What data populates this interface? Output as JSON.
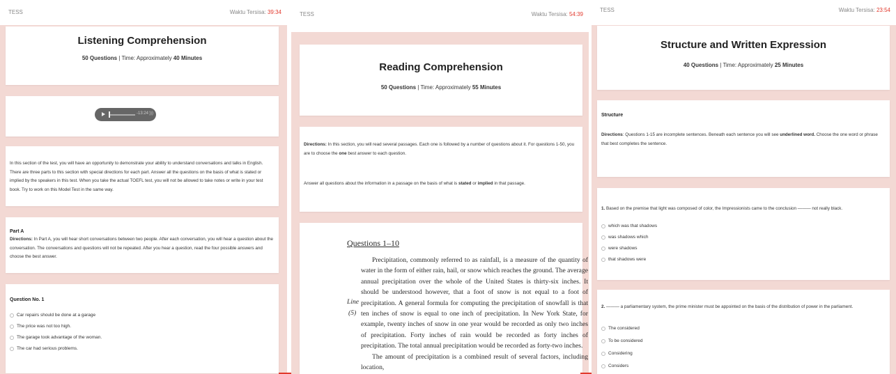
{
  "colors": {
    "accent_timer": "#e23a2e",
    "panel_bg": "#f3d9d4",
    "card_bg": "#ffffff"
  },
  "panel1": {
    "brand": "TESS",
    "timer_label": "Waktu Tersisa:",
    "timer_value": "39:34",
    "title": "Listening Comprehension",
    "meta": {
      "count": "50 Questions",
      "sep_time": " | Time: Approximately ",
      "duration": "40 Minutes"
    },
    "audio": {
      "time": "-13:24",
      "play_icon": "play-icon",
      "volume_icon": "volume-icon"
    },
    "intro": "In this section of the test, you will have an opportunity to demonstrate your ability to understand conversations and talks in English. There are three parts to this section with special directions for each part. Answer all the questions on the basis of what is stated or implied by the speakers in this test. When you take the actual TOEFL test, you will not be allowed to take notes or write in your test book. Try to work on this Model Test in the same way.",
    "part": {
      "heading": "Part A",
      "directions_label": "Directions:",
      "directions": " In Part A, you will hear short conversations between two people. After each conversation, you will hear a question about the conversation. The conversations and questions will not be repeated. After you hear a question, read the four possible answers and choose the best answer."
    },
    "question": {
      "heading": "Question No. 1",
      "options": [
        "Car repairs should be done at a garage",
        "The price was not too high.",
        "The garage took advantage of the woman.",
        "The car had serious problems."
      ]
    }
  },
  "panel2": {
    "brand": "TESS",
    "timer_label": "Waktu Tersisa:",
    "timer_value": "54:39",
    "title": "Reading Comprehension",
    "meta": {
      "count": "50 Questions",
      "sep_time": " | Time: Approximately ",
      "duration": "55 Minutes"
    },
    "directions_label": "Directions:",
    "directions_a": " In this section, you will read several passages. Each one is followed by a number of questions about it. For questions 1-50, you are to choose the ",
    "directions_bold": "one",
    "directions_b": " best answer to each question.",
    "answer_a": "Answer all questions about the information in a passage on the basis of what is ",
    "answer_stated": "stated",
    "answer_or": " or ",
    "answer_implied": "implied",
    "answer_b": " in that passage.",
    "passage": {
      "heading": "Questions 1–10",
      "line_label": "Line",
      "line_number": "(5)",
      "p1": "Precipitation, commonly referred to as rainfall, is a measure of the quantity of water in the form of either rain, hail, or snow which reaches the ground. The average annual precipitation over the whole of the United States is thirty-six inches. It should be understood however, that a foot of snow is not equal to a foot of precipitation. A general formula for computing the precipitation of snowfall is that ten inches of snow is equal to one inch of precipitation. In New York State, for example, twenty inches of snow in one year would be recorded as only two inches of precipitation. Forty inches of rain would be recorded as forty inches of precipitation. The total annual precipitation would be recorded as forty-two inches.",
      "p2": "The amount of precipitation is a combined result of several factors, including location,"
    }
  },
  "panel3": {
    "brand": "TESS",
    "timer_label": "Waktu Tersisa:",
    "timer_value": "23:54",
    "title": "Structure and Written Expression",
    "meta": {
      "count": "40 Questions",
      "sep_time": " | Time: Approximately ",
      "duration": "25 Minutes"
    },
    "section_heading": "Structure",
    "directions_label": "Directions",
    "directions_a": ": Questions 1-15 are incomplete sentences. Beneath each sentence you will see ",
    "directions_bold": "underlined word.",
    "directions_b": " Choose the one word or phrase that best completes the sentence.",
    "q1": {
      "number": "1.",
      "text": "Based on the premise that light was composed of color, the Impressionists came to the conclusion ——— not really black.",
      "options": [
        "which was that shadows",
        "was shadows which",
        "were shadows",
        "that shadows were"
      ]
    },
    "q2": {
      "number": "2.",
      "text": "——— a parliamentary system, the prime minister must be appointed on the basis of the distribution of power in the parliament.",
      "options": [
        "The considered",
        "To be considered",
        "Considering",
        "Considers"
      ]
    }
  }
}
